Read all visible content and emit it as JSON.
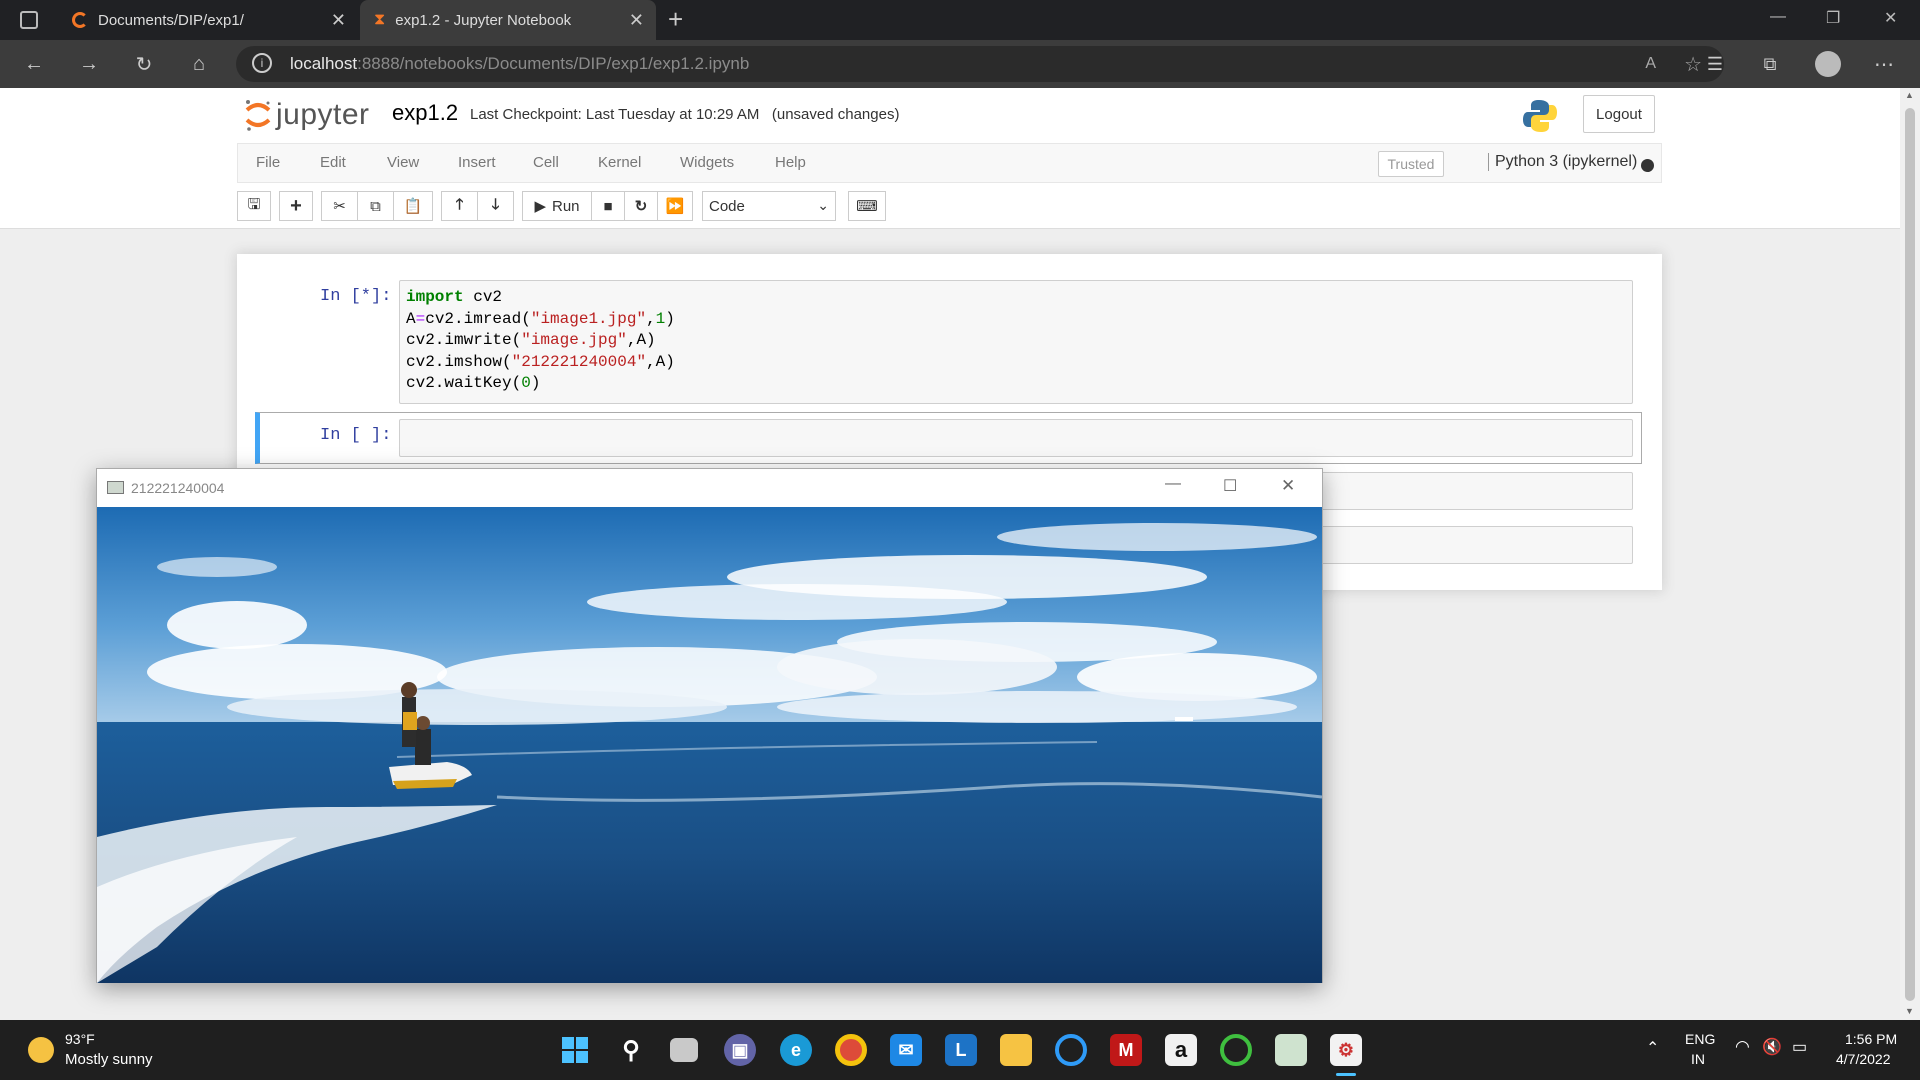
{
  "browser": {
    "tabs": [
      {
        "label": "Documents/DIP/exp1/",
        "active": false
      },
      {
        "label": "exp1.2 - Jupyter Notebook",
        "active": true
      }
    ],
    "new_tab": "+",
    "url_host": "localhost",
    "url_rest": ":8888/notebooks/Documents/DIP/exp1/exp1.2.ipynb"
  },
  "jupyter": {
    "logo": "jupyter",
    "notebook_name": "exp1.2",
    "checkpoint": "Last Checkpoint: Last Tuesday at 10:29 AM",
    "unsaved": "(unsaved changes)",
    "logout": "Logout",
    "menu": [
      "File",
      "Edit",
      "View",
      "Insert",
      "Cell",
      "Kernel",
      "Widgets",
      "Help"
    ],
    "trusted": "Trusted",
    "kernel": "Python 3 (ipykernel)",
    "toolbar": {
      "run": "Run",
      "cell_type": "Code"
    }
  },
  "cells": [
    {
      "prompt": "In [*]:"
    },
    {
      "prompt": "In [ ]:"
    }
  ],
  "cv_window": {
    "title": "212221240004"
  },
  "taskbar": {
    "weather_temp": "93°F",
    "weather_desc": "Mostly sunny",
    "lang1": "ENG",
    "lang2": "IN",
    "time": "1:56 PM",
    "date": "4/7/2022"
  },
  "colors": {
    "accent_cell": "#42a5f5",
    "python_blue": "#3670a0",
    "python_yellow": "#ffd43b"
  }
}
